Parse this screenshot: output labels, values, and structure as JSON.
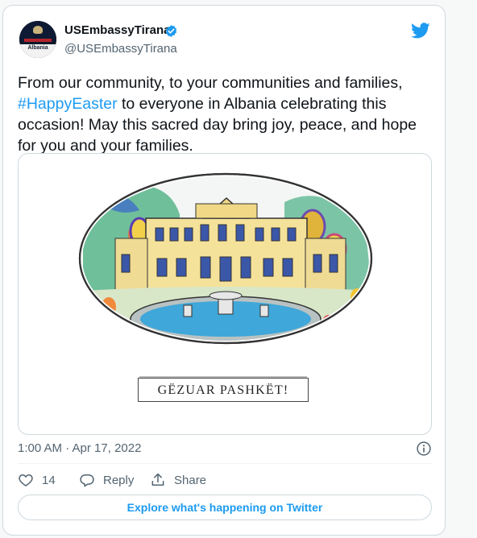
{
  "author": {
    "display_name": "USEmbassyTirana",
    "handle": "@USEmbassyTirana",
    "avatar_text": "Albania",
    "verified_icon": "verified-badge-icon"
  },
  "tweet": {
    "text_before_hashtag": "From our community, to your communities and families,",
    "hashtag": "#HappyEaster",
    "text_after_hashtag": " to everyone in Albania celebrating this occasion! May this sacred day bring joy, peace, and hope for you and your families.",
    "image": {
      "caption_text": "GËZUAR PASHKËT!"
    },
    "timestamp": "1:00 AM · Apr 17, 2022"
  },
  "actions": {
    "like_count": "14",
    "reply_label": "Reply",
    "share_label": "Share"
  },
  "footer": {
    "explore_label": "Explore what's happening on Twitter"
  },
  "colors": {
    "accent": "#1d9bf0",
    "text": "#0f1419",
    "muted": "#536471",
    "border": "#cfd9de"
  }
}
